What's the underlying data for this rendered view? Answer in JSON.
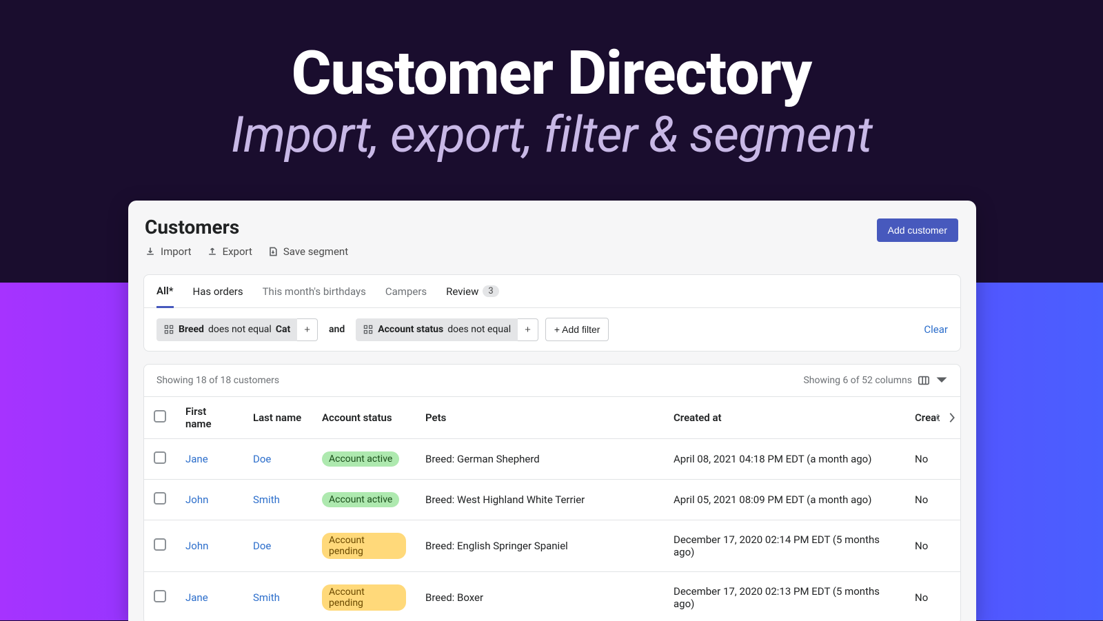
{
  "hero": {
    "title": "Customer Directory",
    "subtitle": "Import, export, filter & segment"
  },
  "header": {
    "title": "Customers",
    "import_label": "Import",
    "export_label": "Export",
    "save_segment_label": "Save segment",
    "add_customer_label": "Add customer"
  },
  "tabs": [
    {
      "label": "All*",
      "active": true
    },
    {
      "label": "Has orders"
    },
    {
      "label": "This month's birthdays",
      "muted": true
    },
    {
      "label": "Campers",
      "muted": true
    },
    {
      "label": "Review",
      "count": 3
    }
  ],
  "filters": {
    "chip1_field": "Breed",
    "chip1_op": "does not equal",
    "chip1_val": "Cat",
    "and": "and",
    "chip2_field": "Account status",
    "chip2_op": "does not equal",
    "add_filter": "+ Add filter",
    "clear": "Clear"
  },
  "table_meta": {
    "showing_rows": "Showing 18 of 18 customers",
    "showing_cols": "Showing 6 of 52 columns"
  },
  "columns": [
    "First name",
    "Last name",
    "Account status",
    "Pets",
    "Created at",
    "Creat"
  ],
  "rows": [
    {
      "first": "Jane",
      "last": "Doe",
      "status": "Account active",
      "status_kind": "active",
      "pets": "Breed: German Shepherd",
      "created": "April 08, 2021 04:18 PM EDT (a month ago)",
      "extra": "No"
    },
    {
      "first": "John",
      "last": "Smith",
      "status": "Account active",
      "status_kind": "active",
      "pets": "Breed: West Highland White Terrier",
      "created": "April 05, 2021 08:09 PM EDT (a month ago)",
      "extra": "No"
    },
    {
      "first": "John",
      "last": "Doe",
      "status": "Account pending",
      "status_kind": "pending",
      "pets": "Breed: English Springer Spaniel",
      "created": "December 17, 2020 02:14 PM EDT (5 months ago)",
      "extra": "No"
    },
    {
      "first": "Jane",
      "last": "Smith",
      "status": "Account pending",
      "status_kind": "pending",
      "pets": "Breed: Boxer",
      "created": "December 17, 2020 02:13 PM EDT (5 months ago)",
      "extra": "No"
    }
  ]
}
